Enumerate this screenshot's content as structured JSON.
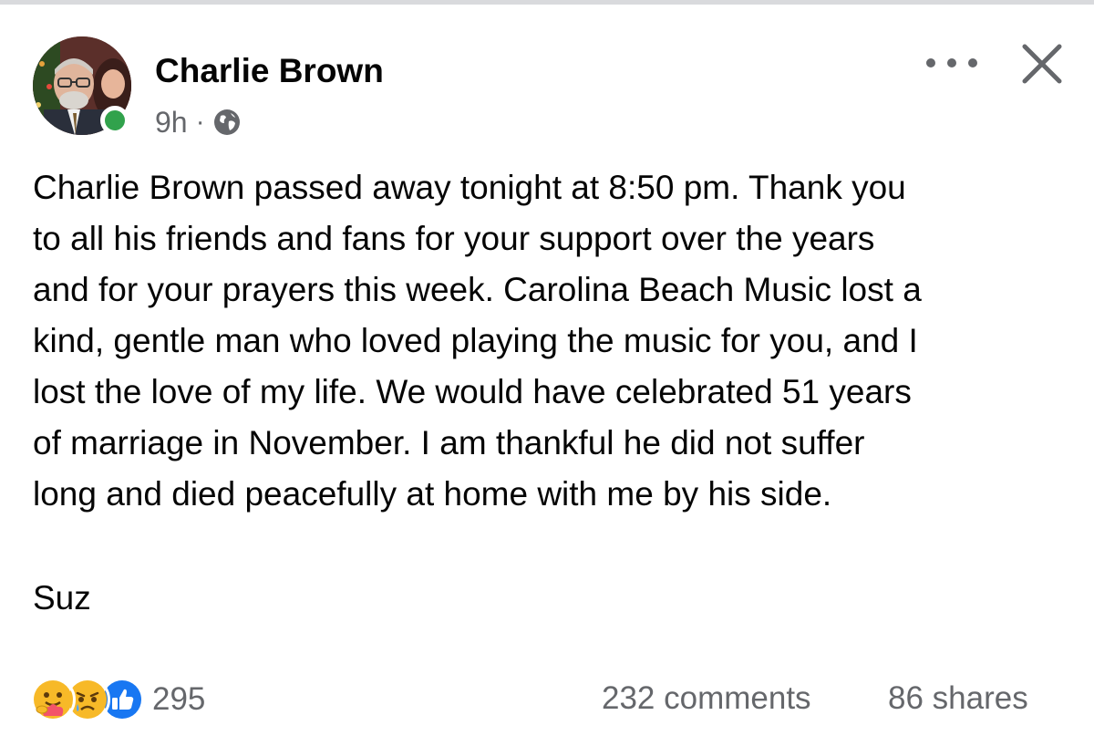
{
  "post": {
    "author": "Charlie Brown",
    "time": "9h",
    "separator": "·",
    "audience_icon": "globe-icon",
    "body_lines": [
      "Charlie Brown passed away tonight at 8:50 pm. Thank you",
      "to all his friends and fans for your support over the years",
      "and for your prayers this week. Carolina Beach Music lost a",
      "kind, gentle man who loved playing the music for you, and I",
      "lost the love of my life. We would have celebrated 51 years",
      "of marriage in November. I am thankful he did not suffer",
      "long and died peacefully at home with me by his side."
    ],
    "signature": "Suz"
  },
  "footer": {
    "reaction_icons": [
      "care-reaction-icon",
      "sad-reaction-icon",
      "like-reaction-icon"
    ],
    "reaction_count": "295",
    "comments": "232 comments",
    "shares": "86 shares"
  },
  "colors": {
    "text": "#050505",
    "secondary": "#65676b",
    "online": "#31a24c",
    "like": "#1877f2",
    "reaction_yellow": "#f7b928"
  }
}
